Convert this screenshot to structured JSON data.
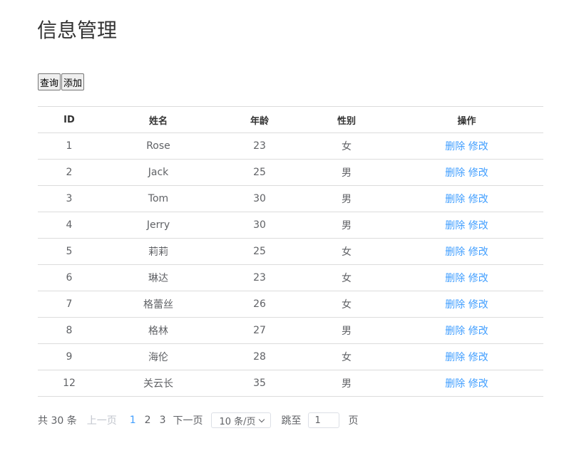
{
  "page": {
    "title": "信息管理"
  },
  "toolbar": {
    "query_label": "查询",
    "add_label": "添加"
  },
  "table": {
    "headers": {
      "id": "ID",
      "name": "姓名",
      "age": "年龄",
      "sex": "性别",
      "op": "操作"
    },
    "rows": [
      {
        "id": "1",
        "name": "Rose",
        "age": "23",
        "sex": "女",
        "delete": "删除",
        "edit": "修改"
      },
      {
        "id": "2",
        "name": "Jack",
        "age": "25",
        "sex": "男",
        "delete": "删除",
        "edit": "修改"
      },
      {
        "id": "3",
        "name": "Tom",
        "age": "30",
        "sex": "男",
        "delete": "删除",
        "edit": "修改"
      },
      {
        "id": "4",
        "name": "Jerry",
        "age": "30",
        "sex": "男",
        "delete": "删除",
        "edit": "修改"
      },
      {
        "id": "5",
        "name": "莉莉",
        "age": "25",
        "sex": "女",
        "delete": "删除",
        "edit": "修改"
      },
      {
        "id": "6",
        "name": "琳达",
        "age": "23",
        "sex": "女",
        "delete": "删除",
        "edit": "修改"
      },
      {
        "id": "7",
        "name": "格蕾丝",
        "age": "26",
        "sex": "女",
        "delete": "删除",
        "edit": "修改"
      },
      {
        "id": "8",
        "name": "格林",
        "age": "27",
        "sex": "男",
        "delete": "删除",
        "edit": "修改"
      },
      {
        "id": "9",
        "name": "海伦",
        "age": "28",
        "sex": "女",
        "delete": "删除",
        "edit": "修改"
      },
      {
        "id": "12",
        "name": "关云长",
        "age": "35",
        "sex": "男",
        "delete": "删除",
        "edit": "修改"
      }
    ]
  },
  "pagination": {
    "total": "共 30 条",
    "prev": "上一页",
    "pages": [
      "1",
      "2",
      "3"
    ],
    "current_page": "1",
    "next": "下一页",
    "page_size": "10 条/页",
    "jump_label": "跳至",
    "jump_value": "1",
    "page_suffix": "页"
  },
  "colors": {
    "link": "#409eff",
    "disabled": "#c0c4cc",
    "text": "#606266",
    "border": "#dcdcdc"
  },
  "icons": {
    "page_size_dropdown": "chevron-down-icon"
  }
}
